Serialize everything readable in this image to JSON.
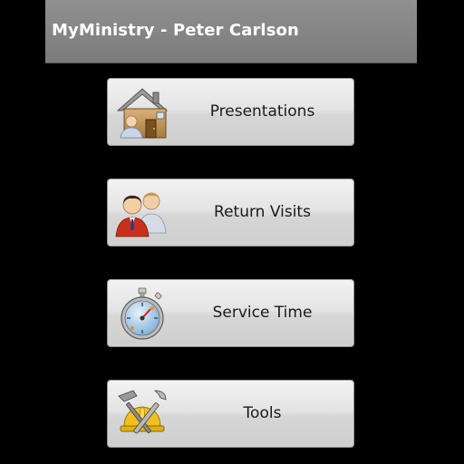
{
  "app": {
    "title": "MyMinistry - Peter Carlson"
  },
  "menu": {
    "items": [
      {
        "label": "Presentations",
        "icon": "house-icon"
      },
      {
        "label": "Return Visits",
        "icon": "people-icon"
      },
      {
        "label": "Service Time",
        "icon": "stopwatch-icon"
      },
      {
        "label": "Tools",
        "icon": "tools-icon"
      }
    ]
  },
  "colors": {
    "titlebar": "#858585",
    "title_text": "#ffffff",
    "background": "#000000",
    "button_face": "#dedede"
  }
}
